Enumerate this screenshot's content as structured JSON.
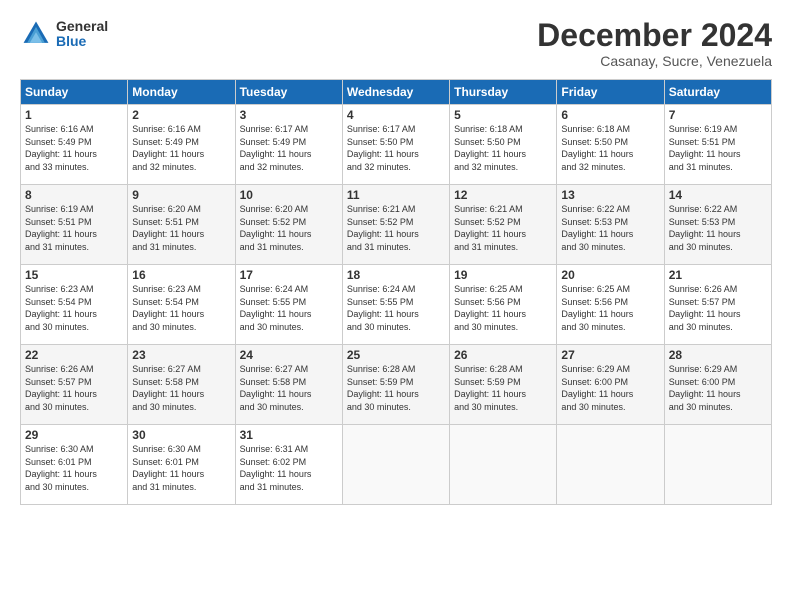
{
  "logo": {
    "general": "General",
    "blue": "Blue"
  },
  "title": "December 2024",
  "location": "Casanay, Sucre, Venezuela",
  "days_header": [
    "Sunday",
    "Monday",
    "Tuesday",
    "Wednesday",
    "Thursday",
    "Friday",
    "Saturday"
  ],
  "weeks": [
    [
      {
        "day": "1",
        "info": "Sunrise: 6:16 AM\nSunset: 5:49 PM\nDaylight: 11 hours\nand 33 minutes."
      },
      {
        "day": "2",
        "info": "Sunrise: 6:16 AM\nSunset: 5:49 PM\nDaylight: 11 hours\nand 32 minutes."
      },
      {
        "day": "3",
        "info": "Sunrise: 6:17 AM\nSunset: 5:49 PM\nDaylight: 11 hours\nand 32 minutes."
      },
      {
        "day": "4",
        "info": "Sunrise: 6:17 AM\nSunset: 5:50 PM\nDaylight: 11 hours\nand 32 minutes."
      },
      {
        "day": "5",
        "info": "Sunrise: 6:18 AM\nSunset: 5:50 PM\nDaylight: 11 hours\nand 32 minutes."
      },
      {
        "day": "6",
        "info": "Sunrise: 6:18 AM\nSunset: 5:50 PM\nDaylight: 11 hours\nand 32 minutes."
      },
      {
        "day": "7",
        "info": "Sunrise: 6:19 AM\nSunset: 5:51 PM\nDaylight: 11 hours\nand 31 minutes."
      }
    ],
    [
      {
        "day": "8",
        "info": "Sunrise: 6:19 AM\nSunset: 5:51 PM\nDaylight: 11 hours\nand 31 minutes."
      },
      {
        "day": "9",
        "info": "Sunrise: 6:20 AM\nSunset: 5:51 PM\nDaylight: 11 hours\nand 31 minutes."
      },
      {
        "day": "10",
        "info": "Sunrise: 6:20 AM\nSunset: 5:52 PM\nDaylight: 11 hours\nand 31 minutes."
      },
      {
        "day": "11",
        "info": "Sunrise: 6:21 AM\nSunset: 5:52 PM\nDaylight: 11 hours\nand 31 minutes."
      },
      {
        "day": "12",
        "info": "Sunrise: 6:21 AM\nSunset: 5:52 PM\nDaylight: 11 hours\nand 31 minutes."
      },
      {
        "day": "13",
        "info": "Sunrise: 6:22 AM\nSunset: 5:53 PM\nDaylight: 11 hours\nand 30 minutes."
      },
      {
        "day": "14",
        "info": "Sunrise: 6:22 AM\nSunset: 5:53 PM\nDaylight: 11 hours\nand 30 minutes."
      }
    ],
    [
      {
        "day": "15",
        "info": "Sunrise: 6:23 AM\nSunset: 5:54 PM\nDaylight: 11 hours\nand 30 minutes."
      },
      {
        "day": "16",
        "info": "Sunrise: 6:23 AM\nSunset: 5:54 PM\nDaylight: 11 hours\nand 30 minutes."
      },
      {
        "day": "17",
        "info": "Sunrise: 6:24 AM\nSunset: 5:55 PM\nDaylight: 11 hours\nand 30 minutes."
      },
      {
        "day": "18",
        "info": "Sunrise: 6:24 AM\nSunset: 5:55 PM\nDaylight: 11 hours\nand 30 minutes."
      },
      {
        "day": "19",
        "info": "Sunrise: 6:25 AM\nSunset: 5:56 PM\nDaylight: 11 hours\nand 30 minutes."
      },
      {
        "day": "20",
        "info": "Sunrise: 6:25 AM\nSunset: 5:56 PM\nDaylight: 11 hours\nand 30 minutes."
      },
      {
        "day": "21",
        "info": "Sunrise: 6:26 AM\nSunset: 5:57 PM\nDaylight: 11 hours\nand 30 minutes."
      }
    ],
    [
      {
        "day": "22",
        "info": "Sunrise: 6:26 AM\nSunset: 5:57 PM\nDaylight: 11 hours\nand 30 minutes."
      },
      {
        "day": "23",
        "info": "Sunrise: 6:27 AM\nSunset: 5:58 PM\nDaylight: 11 hours\nand 30 minutes."
      },
      {
        "day": "24",
        "info": "Sunrise: 6:27 AM\nSunset: 5:58 PM\nDaylight: 11 hours\nand 30 minutes."
      },
      {
        "day": "25",
        "info": "Sunrise: 6:28 AM\nSunset: 5:59 PM\nDaylight: 11 hours\nand 30 minutes."
      },
      {
        "day": "26",
        "info": "Sunrise: 6:28 AM\nSunset: 5:59 PM\nDaylight: 11 hours\nand 30 minutes."
      },
      {
        "day": "27",
        "info": "Sunrise: 6:29 AM\nSunset: 6:00 PM\nDaylight: 11 hours\nand 30 minutes."
      },
      {
        "day": "28",
        "info": "Sunrise: 6:29 AM\nSunset: 6:00 PM\nDaylight: 11 hours\nand 30 minutes."
      }
    ],
    [
      {
        "day": "29",
        "info": "Sunrise: 6:30 AM\nSunset: 6:01 PM\nDaylight: 11 hours\nand 30 minutes."
      },
      {
        "day": "30",
        "info": "Sunrise: 6:30 AM\nSunset: 6:01 PM\nDaylight: 11 hours\nand 31 minutes."
      },
      {
        "day": "31",
        "info": "Sunrise: 6:31 AM\nSunset: 6:02 PM\nDaylight: 11 hours\nand 31 minutes."
      },
      {
        "day": "",
        "info": ""
      },
      {
        "day": "",
        "info": ""
      },
      {
        "day": "",
        "info": ""
      },
      {
        "day": "",
        "info": ""
      }
    ]
  ]
}
